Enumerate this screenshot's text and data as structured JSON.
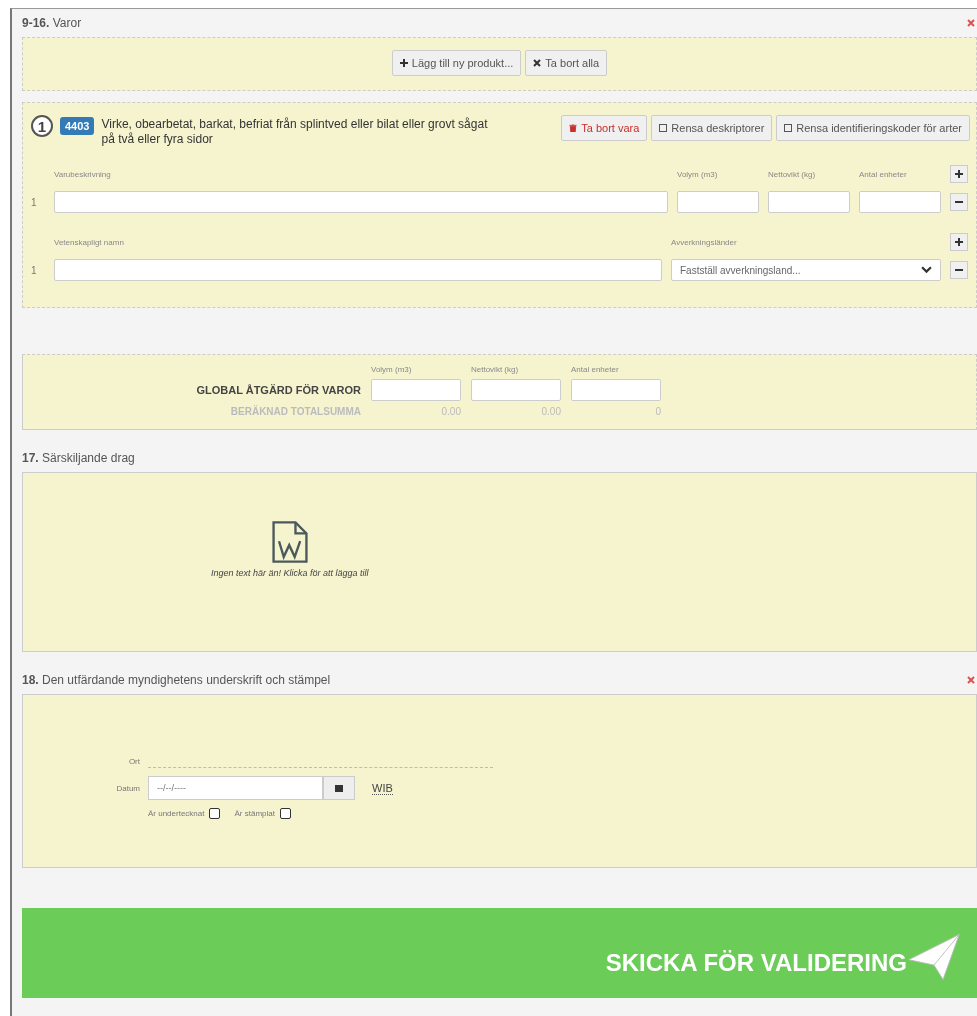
{
  "goods_section": {
    "title": "**9-16.** Varor",
    "buttons": [
      {
        "kind": "add",
        "label": "Lägg till ny produkt..."
      },
      {
        "kind": "remove",
        "label": "Ta bort alla"
      }
    ]
  },
  "product": {
    "number": "1",
    "code": "4403",
    "description": "Virke, obearbetat, barkat, befriat från splintved eller bilat eller grovt sågat på två eller fyra sidor",
    "actions": [
      {
        "kind": "delete",
        "label": "Ta bort vara"
      },
      {
        "kind": "clear",
        "label": "Rensa deskriptorer"
      },
      {
        "kind": "clear",
        "label": "Rensa identifieringskoder för arter"
      }
    ],
    "goods_rows": {
      "columns": [
        "Varubeskrivning",
        "Volym (m3)",
        "Nettovikt (kg)",
        "Antal enheter"
      ],
      "row_index": "1"
    },
    "species_rows": {
      "columns": [
        "Vetenskapligt namn",
        "Avverkningsländer"
      ],
      "row_index": "1",
      "select_placeholder": "Fastställ avverkningsland..."
    }
  },
  "global": {
    "columns": [
      "Volym (m3)",
      "Nettovikt (kg)",
      "Antal enheter"
    ],
    "label": "GLOBAL ÅTGÄRD FÖR VAROR",
    "total_label": "BERÄKNAD TOTALSUMMA",
    "totals": [
      "0.00",
      "0.00",
      "0"
    ]
  },
  "features_section": {
    "title": "**17.** Särskiljande drag",
    "empty_text": "Ingen text här än! Klicka för att lägga till"
  },
  "signature_section": {
    "title": "**18.** Den utfärdande myndighetens underskrift och stämpel",
    "place_label": "Ort",
    "date_label": "Datum",
    "date_placeholder": "--/--/----",
    "timezone": "WIB",
    "checks": [
      {
        "label": "Är undertecknat",
        "checked": false
      },
      {
        "label": "Är stämplat",
        "checked": false
      }
    ]
  },
  "submit": {
    "label": "SKICKA FÖR VALIDERING"
  }
}
